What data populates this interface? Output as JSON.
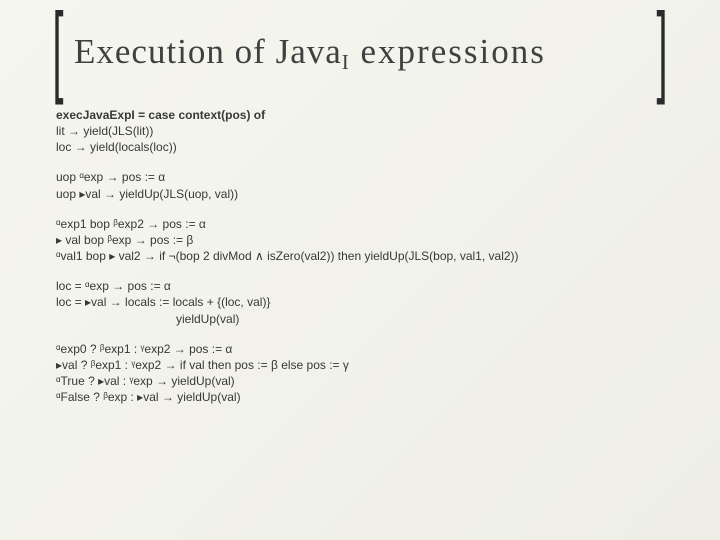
{
  "title": {
    "pre": "Execution of Java",
    "sub": "I",
    "post": " expressions"
  },
  "defline": "execJavaExpI = case context(pos) of",
  "r_lit": "lit → yield(JLS(lit))",
  "r_loc": "loc → yield(locals(loc))",
  "r_uop1": "uop ᵅexp → pos := α",
  "r_uop2": "uop ▸val → yieldUp(JLS(uop, val))",
  "r_bop1": "ᵅexp1 bop ᵝexp2 → pos := α",
  "r_bop2": "▸ val bop ᵝexp → pos := β",
  "r_bop3": "ᵅval1 bop ▸ val2 → if ¬(bop 2 divMod ∧ isZero(val2)) then yieldUp(JLS(bop, val1, val2))",
  "r_asg1": "loc = ᵅexp → pos := α",
  "r_asg2": "loc = ▸val → locals := locals + {(loc, val)}",
  "r_asg3": "yieldUp(val)",
  "r_tern1": "ᵅexp0 ? ᵝexp1 : ᵞexp2 → pos := α",
  "r_tern2": "▸val ? ᵝexp1 : ᵞexp2 → if val then pos := β else pos := γ",
  "r_tern3": "ᵅTrue ? ▸val : ᵞexp → yieldUp(val)",
  "r_tern4": "ᵅFalse ? ᵝexp : ▸val → yieldUp(val)"
}
